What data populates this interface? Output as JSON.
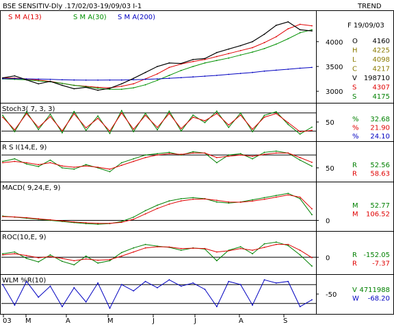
{
  "header": {
    "title": "BSE SENSITIV-Dly .17/02/03-19/09/03  I-1",
    "trend": "TREND",
    "date": "F 19/09/03"
  },
  "colors": {
    "price": "#000000",
    "sma13": "#e00000",
    "sma30": "#009000",
    "sma200": "#0000c0",
    "green": "#008000",
    "red": "#e00000",
    "blue": "#0000c0",
    "olive": "#8a7a00"
  },
  "chart_data": [
    {
      "type": "line",
      "panel": "price",
      "legend": [
        "S M A(13)",
        "S M A(30)",
        "S M A(200)"
      ],
      "y_ticks": [
        "4000",
        "3500",
        "3000"
      ],
      "y_tick_values": [
        4000,
        3500,
        3000
      ],
      "ylim": [
        2850,
        4550
      ],
      "series": [
        {
          "name": "S M A(13)",
          "values": [
            3270,
            3265,
            3250,
            3225,
            3200,
            3160,
            3120,
            3100,
            3080,
            3070,
            3100,
            3150,
            3250,
            3350,
            3480,
            3550,
            3600,
            3640,
            3700,
            3760,
            3820,
            3880,
            3980,
            4100,
            4260,
            4350,
            4320
          ]
        },
        {
          "name": "S M A(30)",
          "values": [
            3250,
            3240,
            3230,
            3210,
            3190,
            3160,
            3120,
            3090,
            3060,
            3040,
            3040,
            3070,
            3130,
            3220,
            3320,
            3420,
            3500,
            3570,
            3620,
            3670,
            3730,
            3790,
            3860,
            3950,
            4060,
            4180,
            4240
          ]
        },
        {
          "name": "S M A(200)",
          "values": [
            3255,
            3255,
            3250,
            3245,
            3240,
            3232,
            3228,
            3225,
            3225,
            3226,
            3228,
            3232,
            3240,
            3250,
            3262,
            3275,
            3290,
            3305,
            3320,
            3340,
            3360,
            3380,
            3405,
            3425,
            3445,
            3465,
            3480
          ]
        },
        {
          "name": "close",
          "values": [
            3270,
            3310,
            3230,
            3150,
            3200,
            3120,
            3050,
            3080,
            3020,
            3060,
            3150,
            3260,
            3380,
            3500,
            3570,
            3560,
            3640,
            3660,
            3780,
            3850,
            3920,
            4000,
            4150,
            4330,
            4400,
            4240,
            4217
          ]
        }
      ],
      "values_panel": [
        {
          "label": "O",
          "value": "4160"
        },
        {
          "label": "H",
          "value": "4225"
        },
        {
          "label": "L",
          "value": "4098"
        },
        {
          "label": "C",
          "value": "4217"
        },
        {
          "label": "V",
          "value": "198710"
        },
        {
          "label": "S",
          "value": "4307"
        },
        {
          "label": "S",
          "value": "4175"
        }
      ]
    },
    {
      "type": "line",
      "panel": "stoch",
      "legend": "Stoch3( 7, 3, 3)",
      "y_ticks": [
        "50"
      ],
      "y_tick_values": [
        50
      ],
      "ylim": [
        0,
        100
      ],
      "bands": [
        20,
        80
      ],
      "series": [
        {
          "name": "%",
          "values": [
            72,
            18,
            84,
            25,
            76,
            14,
            85,
            22,
            70,
            12,
            88,
            18,
            79,
            24,
            86,
            20,
            73,
            48,
            86,
            32,
            80,
            18,
            72,
            84,
            42,
            10,
            33
          ]
        },
        {
          "name": "%",
          "values": [
            66,
            24,
            78,
            32,
            68,
            21,
            77,
            31,
            62,
            20,
            80,
            26,
            72,
            32,
            78,
            28,
            66,
            54,
            78,
            40,
            73,
            26,
            66,
            78,
            48,
            18,
            22
          ]
        }
      ],
      "values_panel": [
        {
          "label": "%",
          "value": "32.68"
        },
        {
          "label": "%",
          "value": "21.90"
        },
        {
          "label": "%",
          "value": "24.10"
        }
      ]
    },
    {
      "type": "line",
      "panel": "rsi",
      "legend": "R S I(14,E, 9)",
      "y_ticks": [
        "50"
      ],
      "y_tick_values": [
        50
      ],
      "ylim": [
        35,
        85
      ],
      "bands": [
        70
      ],
      "series": [
        {
          "name": "R",
          "values": [
            60,
            64,
            56,
            52,
            62,
            50,
            48,
            55,
            50,
            44,
            58,
            64,
            70,
            72,
            74,
            70,
            75,
            73,
            58,
            70,
            72,
            64,
            74,
            76,
            73,
            62,
            52.56
          ]
        },
        {
          "name": "R",
          "values": [
            58,
            60,
            58,
            55,
            58,
            53,
            51,
            53,
            51,
            48,
            54,
            60,
            66,
            70,
            72,
            71,
            73,
            73,
            66,
            68,
            70,
            68,
            71,
            73,
            73,
            66,
            58.63
          ]
        }
      ],
      "values_panel": [
        {
          "label": "R",
          "value": "52.56"
        },
        {
          "label": "R",
          "value": "58.63"
        }
      ]
    },
    {
      "type": "line",
      "panel": "macd",
      "legend": "MACD( 9,24,E, 9)",
      "y_ticks": [
        "0"
      ],
      "y_tick_values": [
        0
      ],
      "ylim": [
        -60,
        320
      ],
      "bands": [
        0
      ],
      "series": [
        {
          "name": "M",
          "values": [
            40,
            30,
            20,
            10,
            0,
            -10,
            -20,
            -30,
            -35,
            -30,
            -10,
            30,
            90,
            140,
            180,
            200,
            210,
            200,
            170,
            160,
            170,
            190,
            210,
            230,
            250,
            200,
            52.77
          ]
        },
        {
          "name": "M",
          "values": [
            35,
            32,
            25,
            15,
            5,
            -5,
            -15,
            -22,
            -28,
            -28,
            -18,
            10,
            60,
            110,
            150,
            180,
            195,
            198,
            185,
            170,
            168,
            178,
            195,
            215,
            235,
            215,
            106.52
          ]
        }
      ],
      "values_panel": [
        {
          "label": "M",
          "value": "52.77"
        },
        {
          "label": "M",
          "value": "106.52"
        }
      ]
    },
    {
      "type": "line",
      "panel": "roc",
      "legend": "ROC(10,E, 9)",
      "y_ticks": [
        "0"
      ],
      "y_tick_values": [
        0
      ],
      "ylim": [
        -220,
        380
      ],
      "bands": [
        0
      ],
      "series": [
        {
          "name": "R",
          "values": [
            60,
            90,
            -20,
            -80,
            40,
            -70,
            -130,
            20,
            -100,
            -60,
            80,
            160,
            220,
            190,
            170,
            120,
            160,
            140,
            -60,
            120,
            180,
            60,
            230,
            260,
            200,
            40,
            -152.05
          ]
        },
        {
          "name": "R",
          "values": [
            40,
            60,
            30,
            -10,
            10,
            -20,
            -60,
            -30,
            -50,
            -40,
            20,
            90,
            160,
            180,
            175,
            150,
            155,
            150,
            90,
            110,
            150,
            120,
            170,
            220,
            220,
            120,
            -7.37
          ]
        }
      ],
      "values_panel": [
        {
          "label": "R",
          "value": "-152.05"
        },
        {
          "label": "R",
          "value": "-7.37"
        }
      ]
    },
    {
      "type": "line",
      "panel": "wlm",
      "legend": "WLM %R(10)",
      "y_ticks": [
        "-50"
      ],
      "y_tick_values": [
        -50
      ],
      "ylim": [
        -100,
        0
      ],
      "bands": [
        -20,
        -80
      ],
      "series": [
        {
          "name": "W",
          "values": [
            -20,
            -85,
            -10,
            -60,
            -25,
            -90,
            -30,
            -75,
            -15,
            -95,
            -20,
            -40,
            -10,
            -30,
            -5,
            -25,
            -15,
            -35,
            -90,
            -10,
            -20,
            -85,
            -5,
            -15,
            -10,
            -90,
            -68.2
          ]
        }
      ],
      "values_panel": [
        {
          "label": "V",
          "value": "4711988"
        },
        {
          "label": "W",
          "value": "-68.20"
        }
      ]
    }
  ],
  "x_axis": {
    "labels": [
      "03",
      "M",
      "A",
      "M",
      "J",
      "J",
      "A",
      "S"
    ]
  }
}
